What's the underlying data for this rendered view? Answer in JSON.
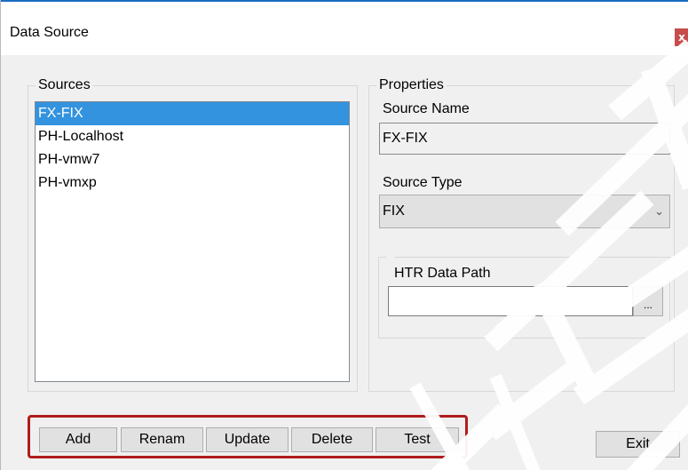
{
  "window": {
    "title": "Data Source",
    "close_label": "x"
  },
  "sources": {
    "group_label": "Sources",
    "items": [
      "FX-FIX",
      "PH-Localhost",
      "PH-vmw7",
      "PH-vmxp"
    ],
    "selected_index": 0
  },
  "properties": {
    "group_label": "Properties",
    "source_name_label": "Source Name",
    "source_name_value": "FX-FIX",
    "source_type_label": "Source Type",
    "source_type_value": "FIX",
    "htr_label": "HTR Data Path",
    "htr_value": "",
    "browse_label": "..."
  },
  "buttons": {
    "add": "Add",
    "rename": "Renam",
    "update": "Update",
    "delete": "Delete",
    "test": "Test",
    "exit": "Exit"
  },
  "colors": {
    "highlight_box": "#b01c1c",
    "selection": "#3393df",
    "close_button": "#c84c4c"
  }
}
